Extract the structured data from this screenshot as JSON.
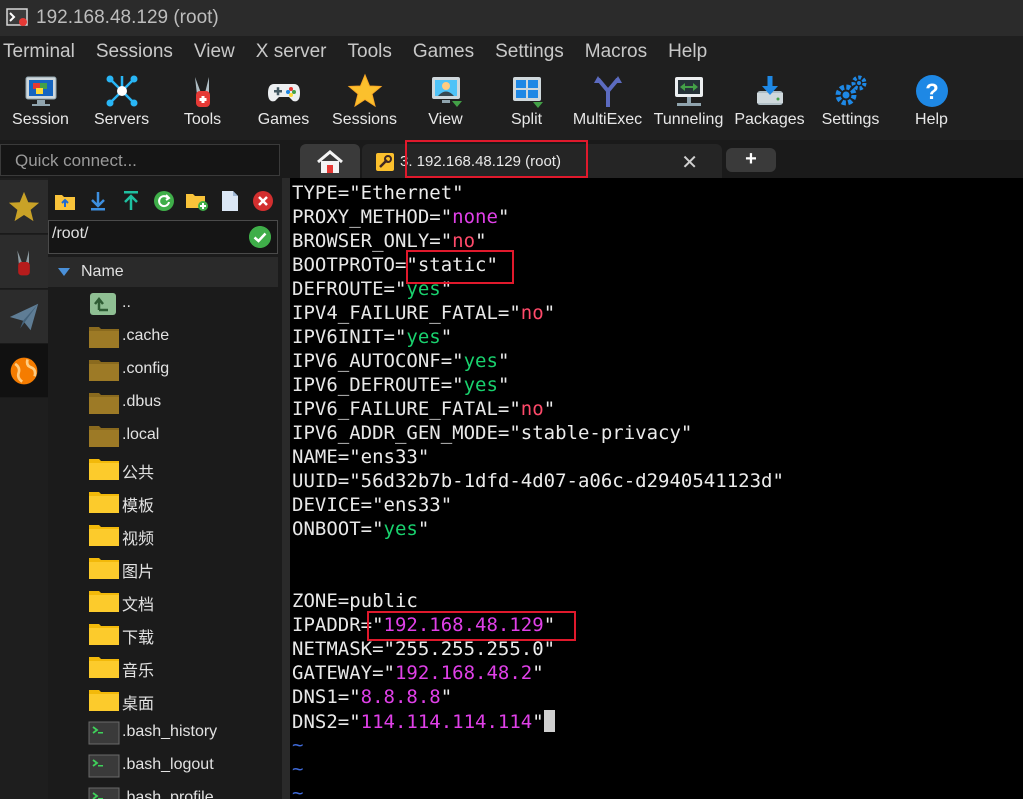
{
  "window": {
    "title": "192.168.48.129 (root)"
  },
  "menu": [
    "Terminal",
    "Sessions",
    "View",
    "X server",
    "Tools",
    "Games",
    "Settings",
    "Macros",
    "Help"
  ],
  "toolbar": [
    {
      "label": "Session",
      "icon": "session-icon"
    },
    {
      "label": "Servers",
      "icon": "servers-icon"
    },
    {
      "label": "Tools",
      "icon": "tools-icon"
    },
    {
      "label": "Games",
      "icon": "gamepad-icon"
    },
    {
      "label": "Sessions",
      "icon": "star-icon"
    },
    {
      "label": "View",
      "icon": "view-icon"
    },
    {
      "label": "Split",
      "icon": "split-icon"
    },
    {
      "label": "MultiExec",
      "icon": "multiexec-icon"
    },
    {
      "label": "Tunneling",
      "icon": "tunneling-icon"
    },
    {
      "label": "Packages",
      "icon": "packages-icon"
    },
    {
      "label": "Settings",
      "icon": "gears-icon"
    },
    {
      "label": "Help",
      "icon": "help-icon"
    }
  ],
  "quick_connect": {
    "placeholder": "Quick connect..."
  },
  "tab": {
    "label": "3. 192.168.48.129 (root)",
    "close": "✕",
    "new": "+"
  },
  "files": {
    "path": "/root/",
    "column": "Name",
    "items": [
      {
        "name": "..",
        "type": "up"
      },
      {
        "name": ".cache",
        "type": "folder-dark"
      },
      {
        "name": ".config",
        "type": "folder-dark"
      },
      {
        "name": ".dbus",
        "type": "folder-dark"
      },
      {
        "name": ".local",
        "type": "folder-dark"
      },
      {
        "name": "公共",
        "type": "folder"
      },
      {
        "name": "模板",
        "type": "folder"
      },
      {
        "name": "视频",
        "type": "folder"
      },
      {
        "name": "图片",
        "type": "folder"
      },
      {
        "name": "文档",
        "type": "folder"
      },
      {
        "name": "下载",
        "type": "folder"
      },
      {
        "name": "音乐",
        "type": "folder"
      },
      {
        "name": "桌面",
        "type": "folder"
      },
      {
        "name": ".bash_history",
        "type": "file"
      },
      {
        "name": ".bash_logout",
        "type": "file"
      },
      {
        "name": ".bash_profile",
        "type": "file"
      }
    ]
  },
  "terminal": {
    "lines": [
      {
        "key": "TYPE=",
        "val": "\"Ethernet\"",
        "color": "white"
      },
      {
        "key": "PROXY_METHOD=",
        "val": "\"none\"",
        "color": "magenta"
      },
      {
        "key": "BROWSER_ONLY=",
        "val": "\"no\"",
        "color": "red"
      },
      {
        "key": "BOOTPROTO=",
        "val": "\"static\"",
        "color": "white"
      },
      {
        "key": "DEFROUTE=",
        "val": "\"yes\"",
        "color": "green"
      },
      {
        "key": "IPV4_FAILURE_FATAL=",
        "val": "\"no\"",
        "color": "red"
      },
      {
        "key": "IPV6INIT=",
        "val": "\"yes\"",
        "color": "green"
      },
      {
        "key": "IPV6_AUTOCONF=",
        "val": "\"yes\"",
        "color": "green"
      },
      {
        "key": "IPV6_DEFROUTE=",
        "val": "\"yes\"",
        "color": "green"
      },
      {
        "key": "IPV6_FAILURE_FATAL=",
        "val": "\"no\"",
        "color": "red"
      },
      {
        "key": "IPV6_ADDR_GEN_MODE=",
        "val": "\"stable-privacy\"",
        "color": "white"
      },
      {
        "key": "NAME=",
        "val": "\"ens33\"",
        "color": "white"
      },
      {
        "key": "UUID=",
        "val": "\"56d32b7b-1dfd-4d07-a06c-d2940541123d\"",
        "color": "white"
      },
      {
        "key": "DEVICE=",
        "val": "\"ens33\"",
        "color": "white"
      },
      {
        "key": "ONBOOT=",
        "val": "\"yes\"",
        "color": "green"
      },
      {
        "key": "",
        "val": "",
        "color": "white"
      },
      {
        "key": "",
        "val": "",
        "color": "white"
      },
      {
        "key": "ZONE=",
        "val": "public",
        "color": "white"
      },
      {
        "key": "IPADDR=",
        "val": "\"192.168.48.129\"",
        "color": "magenta"
      },
      {
        "key": "NETMASK=",
        "val": "\"255.255.255.0\"",
        "color": "white"
      },
      {
        "key": "GATEWAY=",
        "val": "\"192.168.48.2\"",
        "color": "magenta"
      },
      {
        "key": "DNS1=",
        "val": "\"8.8.8.8\"",
        "color": "magenta"
      },
      {
        "key": "DNS2=",
        "val": "\"114.114.114.114\"",
        "color": "magenta"
      },
      {
        "key": "",
        "val": "~",
        "color": "tilde"
      },
      {
        "key": "",
        "val": "~",
        "color": "tilde"
      },
      {
        "key": "",
        "val": "~",
        "color": "tilde"
      }
    ]
  },
  "colors": {
    "highlight": "#e0192c",
    "string_magenta": "#e040e8",
    "string_green": "#19d26e",
    "string_red": "#ff4a6a"
  }
}
